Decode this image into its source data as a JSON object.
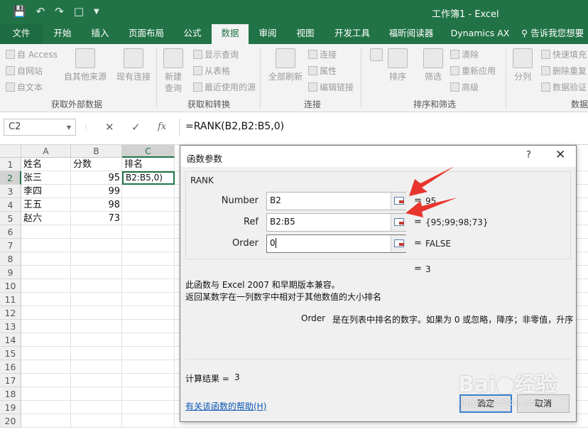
{
  "app": {
    "window_title": "工作簿1 - Excel"
  },
  "tabs": [
    {
      "label": "文件"
    },
    {
      "label": "开始"
    },
    {
      "label": "插入"
    },
    {
      "label": "页面布局"
    },
    {
      "label": "公式"
    },
    {
      "label": "数据"
    },
    {
      "label": "审阅"
    },
    {
      "label": "视图"
    },
    {
      "label": "开发工具"
    },
    {
      "label": "福昕阅读器"
    },
    {
      "label": "Dynamics AX"
    },
    {
      "label": "告诉我您想要"
    }
  ],
  "active_tab": "数据",
  "ribbon": {
    "get_external": {
      "label": "获取外部数据",
      "from_access": "自 Access",
      "from_web": "自网站",
      "from_text": "自文本",
      "from_other": "自其他来源",
      "existing": "现有连接"
    },
    "get_transform": {
      "label": "获取和转换",
      "new_query": "新建\n查询",
      "show_queries": "显示查询",
      "from_table": "从表格",
      "recent_sources": "最近使用的源"
    },
    "connections": {
      "label": "连接",
      "refresh_all": "全部刷新",
      "connections": "连接",
      "properties": "属性",
      "edit_links": "编辑链接"
    },
    "sort_filter": {
      "label": "排序和筛选",
      "sort": "排序",
      "filter": "筛选",
      "clear": "清除",
      "reapply": "重新应用",
      "advanced": "高级"
    },
    "data_tools": {
      "label": "数据",
      "text_to_columns": "分列",
      "flash_fill": "快速填充",
      "remove_duplicates": "删除重复",
      "data_validation": "数据验证"
    }
  },
  "formula_bar": {
    "name_box": "C2",
    "formula": "=RANK(B2,B2:B5,0)"
  },
  "sheet": {
    "columns": [
      "A",
      "B",
      "C"
    ],
    "rows": [
      "1",
      "2",
      "3",
      "4",
      "5",
      "6",
      "7",
      "8",
      "9",
      "10",
      "11",
      "12",
      "13",
      "14",
      "15",
      "16",
      "17",
      "18",
      "19",
      "20"
    ],
    "data": [
      [
        "姓名",
        "分数",
        "排名"
      ],
      [
        "张三",
        "95",
        "B2:B5,0)"
      ],
      [
        "李四",
        "99",
        ""
      ],
      [
        "王五",
        "98",
        ""
      ],
      [
        "赵六",
        "73",
        ""
      ]
    ]
  },
  "dialog": {
    "title": "函数参数",
    "help_glyph": "?",
    "close_glyph": "✕",
    "function_name": "RANK",
    "args": [
      {
        "label": "Number",
        "value": "B2",
        "result": "95"
      },
      {
        "label": "Ref",
        "value": "B2:B5",
        "result": "{95;99;98;73}"
      },
      {
        "label": "Order",
        "value": "0",
        "result": "FALSE"
      }
    ],
    "formula_result_line": "3",
    "desc_line1": "此函数与 Excel 2007 和早期版本兼容。",
    "desc_line2": "返回某数字在一列数字中相对于其他数值的大小排名",
    "arg_help_name": "Order",
    "arg_help_text": "是在列表中排名的数字。如果为 0 或忽略，降序；非零值，升序",
    "calc_result_label": "计算结果 =",
    "calc_result_value": "3",
    "help_link": "有关该函数的帮助(H)",
    "ok_label": "确定",
    "cancel_label": "取消",
    "eq_sign": "="
  },
  "colors": {
    "excel_green": "#217346",
    "arrow_red": "#e8352e"
  }
}
